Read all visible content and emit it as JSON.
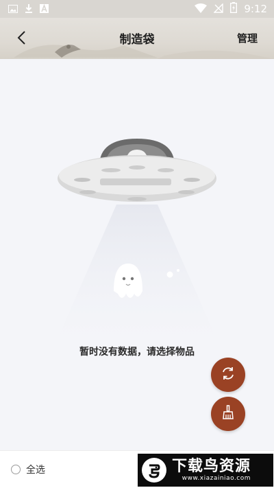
{
  "status_bar": {
    "time": "9:12",
    "left_icons": [
      "image-icon",
      "download-icon",
      "font-a-icon"
    ],
    "right_icons": [
      "wifi-icon",
      "no-signal-icon",
      "battery-charging-icon"
    ]
  },
  "header": {
    "title": "制造袋",
    "manage_label": "管理",
    "back_icon": "chevron-left-icon"
  },
  "content": {
    "empty_message": "暂时没有数据，请选择物品",
    "illustration": "ufo-ghost-illustration"
  },
  "fabs": {
    "refresh_icon": "refresh-icon",
    "clean_icon": "broom-icon",
    "color": "#9a4224"
  },
  "bottom_bar": {
    "select_all_label": "全选",
    "select_all_checked": false
  },
  "watermark": {
    "title": "下载鸟资源",
    "url": "www.xiazainiao.com"
  }
}
